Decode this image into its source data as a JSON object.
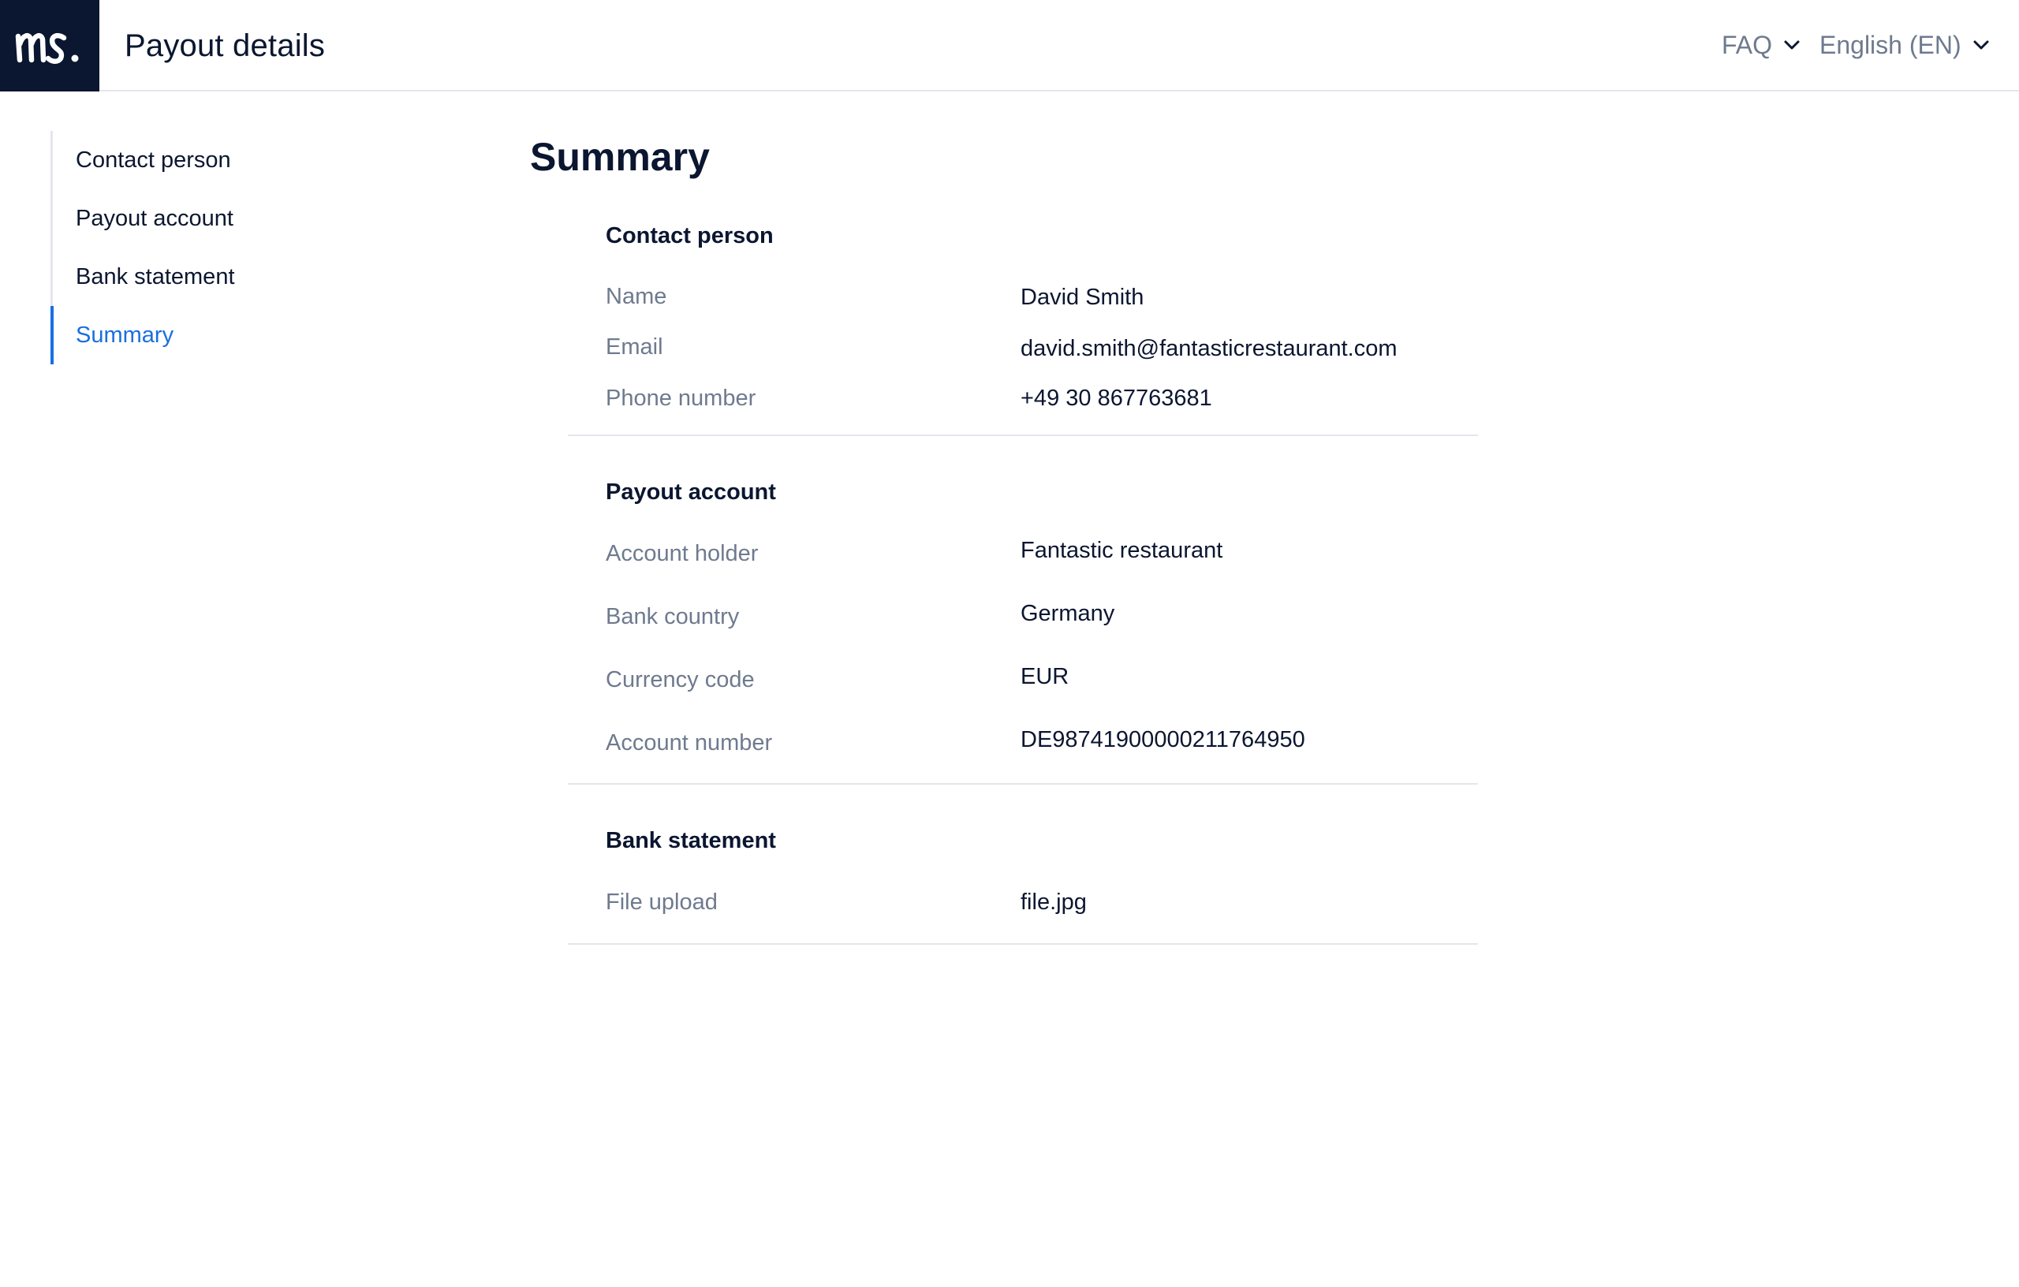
{
  "header": {
    "title": "Payout details",
    "faq_label": "FAQ",
    "language_label": "English (EN)",
    "brand_color": "#0b1630"
  },
  "sidebar": {
    "items": [
      {
        "label": "Contact person"
      },
      {
        "label": "Payout account"
      },
      {
        "label": "Bank statement"
      },
      {
        "label": "Summary",
        "active": true
      }
    ],
    "accent_color": "#1a6fe0"
  },
  "main": {
    "title": "Summary",
    "contact": {
      "title": "Contact person",
      "name_label": "Name",
      "name_value": "David Smith",
      "email_label": "Email",
      "email_value": "david.smith@fantasticrestaurant.com",
      "phone_label": "Phone number",
      "phone_value": "+49 30 867763681"
    },
    "payout": {
      "title": "Payout account",
      "holder_label": "Account holder",
      "holder_value": "Fantastic restaurant",
      "country_label": "Bank country",
      "country_value": "Germany",
      "currency_label": "Currency code",
      "currency_value": "EUR",
      "account_label": "Account number",
      "account_value": "DE98741900000211764950"
    },
    "bank": {
      "title": "Bank statement",
      "file_label": "File upload",
      "file_value": "file.jpg"
    }
  }
}
